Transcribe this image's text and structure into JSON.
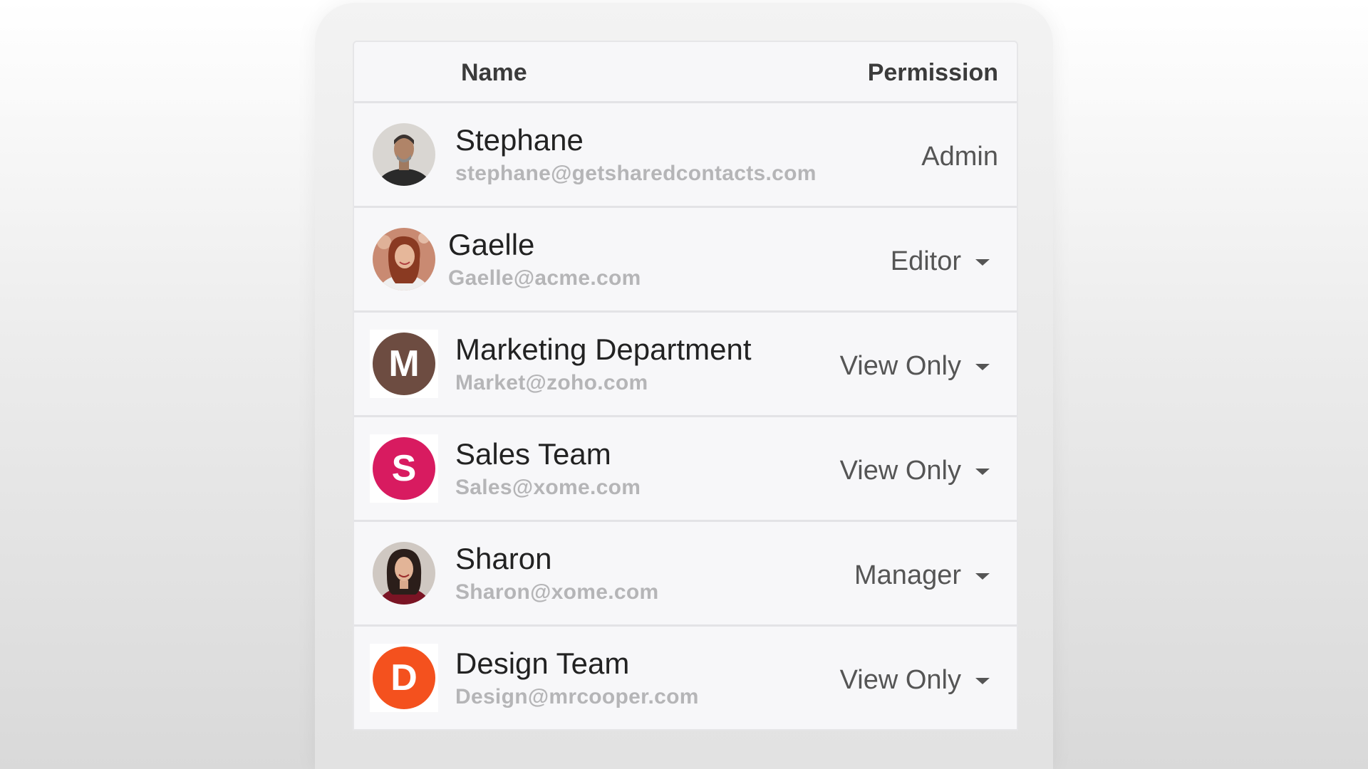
{
  "header": {
    "name_label": "Name",
    "permission_label": "Permission"
  },
  "rows": [
    {
      "name": "Stephane",
      "email": "stephane@getsharedcontacts.com",
      "permission": "Admin",
      "avatar": "photo"
    },
    {
      "name": "Gaelle",
      "email": "Gaelle@acme.com",
      "permission": "Editor",
      "avatar": "photo"
    },
    {
      "name": "Marketing Department",
      "email": "Market@zoho.com",
      "permission": "View Only",
      "avatar_letter": "M",
      "avatar_color": "#6d4c41"
    },
    {
      "name": "Sales Team",
      "email": "Sales@xome.com",
      "permission": "View Only",
      "avatar_letter": "S",
      "avatar_color": "#d81b60"
    },
    {
      "name": "Sharon",
      "email": "Sharon@xome.com",
      "permission": "Manager",
      "avatar": "photo"
    },
    {
      "name": "Design Team",
      "email": "Design@mrcooper.com",
      "permission": "View Only",
      "avatar_letter": "D",
      "avatar_color": "#f4511e"
    }
  ],
  "icons": {
    "dropdown": "caret-down-icon"
  }
}
